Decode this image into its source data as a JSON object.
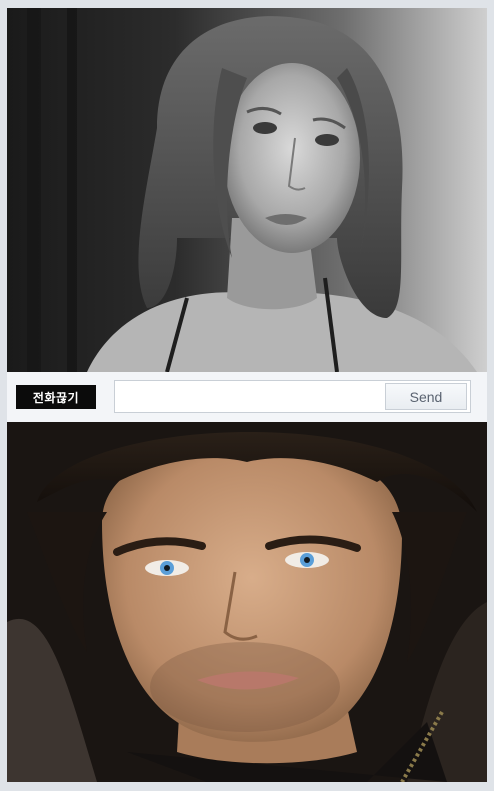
{
  "video_call": {
    "remote_video": {
      "icon": "remote-video-feed"
    },
    "local_video": {
      "icon": "local-video-feed"
    }
  },
  "controls": {
    "hangup_label": "전화끊기",
    "message_value": "",
    "message_placeholder": "",
    "send_label": "Send"
  },
  "colors": {
    "background": "#dfe3e8",
    "bar": "#f3f5f8",
    "hangup": "#0b0b0b",
    "send_text": "#5a6370"
  }
}
